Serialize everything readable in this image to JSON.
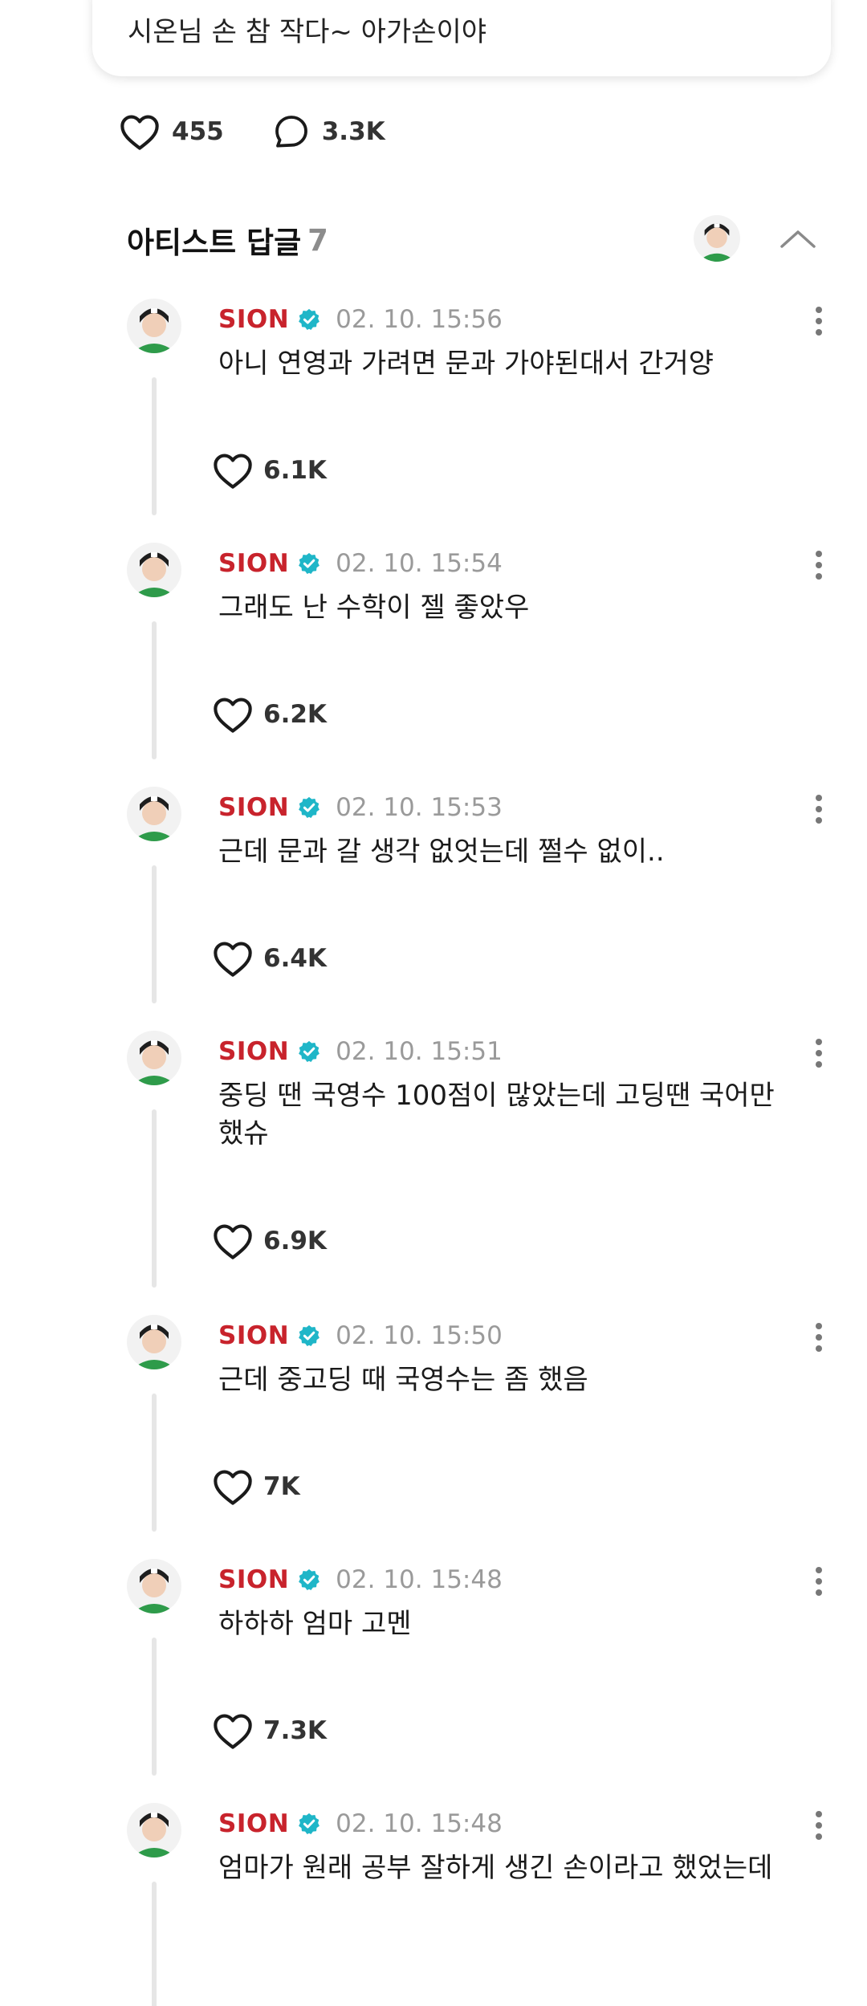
{
  "fan_comment": {
    "text": "시온님 손 참 작다~ 아가손이야",
    "likes": "455",
    "comments": "3.3K"
  },
  "artist_replies": {
    "title": "아티스트 답글",
    "count": "7"
  },
  "replies": [
    {
      "author": "SION",
      "time": "02. 10. 15:56",
      "text": "아니 연영과 가려면 문과 가야된대서 간거양",
      "likes": "6.1K"
    },
    {
      "author": "SION",
      "time": "02. 10. 15:54",
      "text": "그래도 난 수학이 젤 좋았우",
      "likes": "6.2K"
    },
    {
      "author": "SION",
      "time": "02. 10. 15:53",
      "text": "근데 문과 갈 생각 없엇는데 쩔수 없이..",
      "likes": "6.4K"
    },
    {
      "author": "SION",
      "time": "02. 10. 15:51",
      "text": "중딩 땐 국영수 100점이 많았는데 고딩땐 국어만 했슈",
      "likes": "6.9K"
    },
    {
      "author": "SION",
      "time": "02. 10. 15:50",
      "text": "근데 중고딩 때 국영수는 좀 했음",
      "likes": "7K"
    },
    {
      "author": "SION",
      "time": "02. 10. 15:48",
      "text": "하하하 엄마 고멘",
      "likes": "7.3K"
    },
    {
      "author": "SION",
      "time": "02. 10. 15:48",
      "text": "엄마가 원래 공부 잘하게 생긴 손이라고 했었는데",
      "likes": ""
    }
  ],
  "colors": {
    "author": "#c8232c",
    "verified_badge": "#1fb6c8",
    "timestamp": "#9a9a9a",
    "thread_line": "#e6e6e6"
  },
  "icons": [
    "heart-icon",
    "comment-icon",
    "verified-badge-icon",
    "chevron-up-icon",
    "more-vertical-icon"
  ]
}
